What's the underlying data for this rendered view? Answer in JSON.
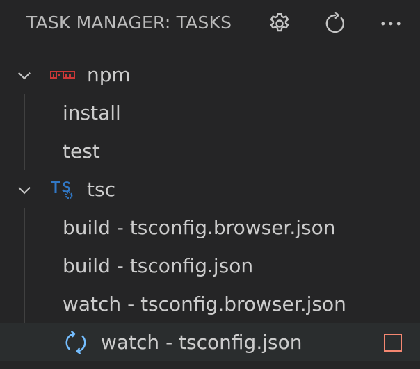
{
  "header": {
    "title": "TASK MANAGER: TASKS",
    "actions": [
      {
        "icon": "gear-icon"
      },
      {
        "icon": "refresh-icon"
      },
      {
        "icon": "more-icon"
      }
    ]
  },
  "tree": {
    "groups": [
      {
        "label": "npm",
        "icon": "npm-icon",
        "expanded": true,
        "tasks": [
          {
            "label": "install"
          },
          {
            "label": "test"
          }
        ]
      },
      {
        "label": "tsc",
        "icon": "typescript-config-icon",
        "expanded": true,
        "tasks": [
          {
            "label": "build - tsconfig.browser.json"
          },
          {
            "label": "build - tsconfig.json"
          },
          {
            "label": "watch - tsconfig.browser.json"
          },
          {
            "label": "watch - tsconfig.json",
            "running": true,
            "selected": true
          }
        ]
      }
    ]
  },
  "colors": {
    "background": "#252526",
    "text": "#cccccc",
    "npm": "#cb3837",
    "typescript": "#3178c6",
    "spinner": "#75beff",
    "stop": "#f48771"
  }
}
